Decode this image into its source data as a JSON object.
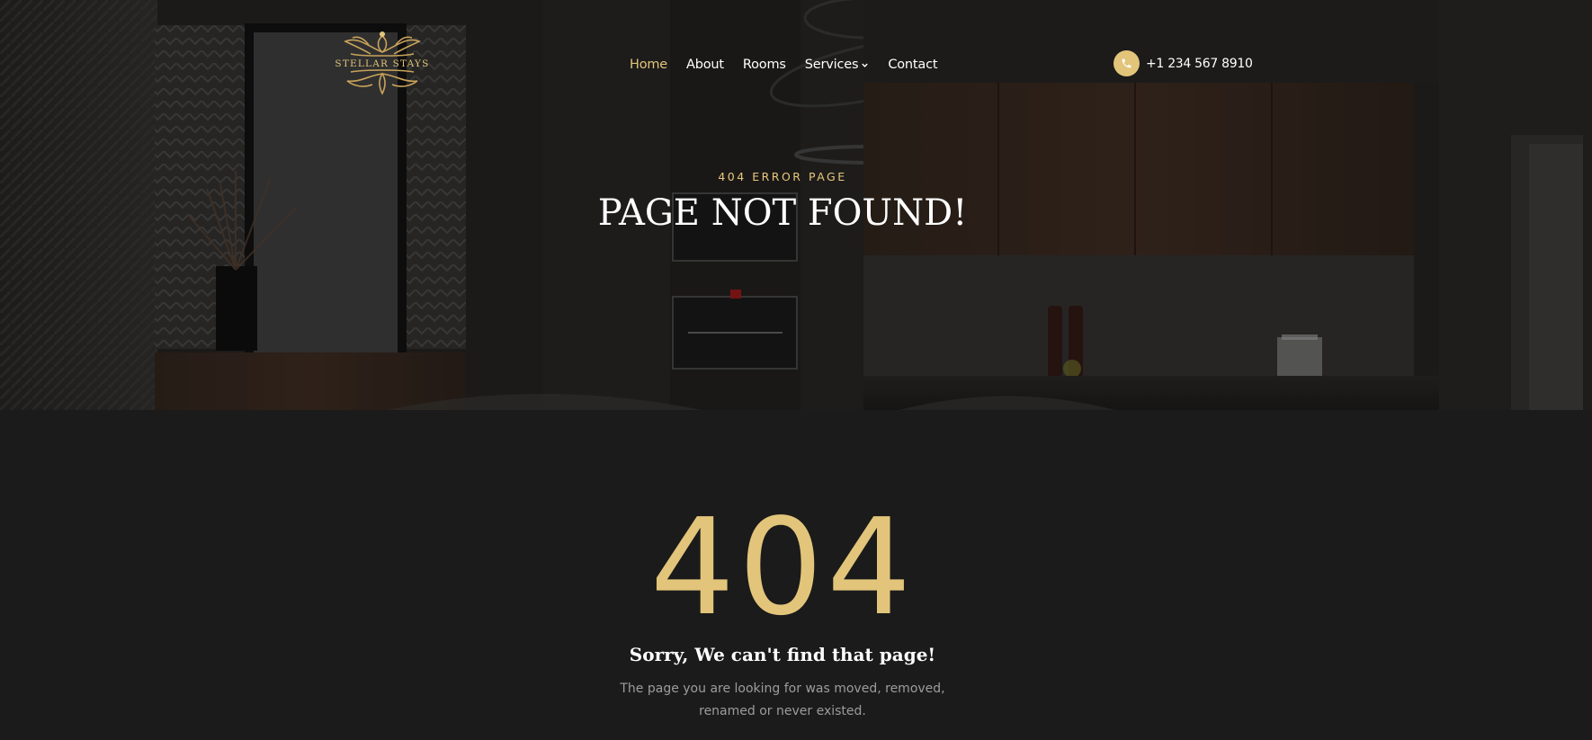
{
  "brand": {
    "name": "STELLAR STAYS",
    "accent": "#e2c57a",
    "background": "#1b1b1b"
  },
  "nav": {
    "items": [
      {
        "label": "Home",
        "active": true
      },
      {
        "label": "About",
        "active": false
      },
      {
        "label": "Rooms",
        "active": false
      },
      {
        "label": "Services",
        "active": false,
        "has_dropdown": true
      },
      {
        "label": "Contact",
        "active": false
      }
    ]
  },
  "contact": {
    "phone": "+1 234 567 8910",
    "icon": "phone-icon"
  },
  "hero": {
    "eyebrow": "404 ERROR PAGE",
    "title": "PAGE NOT FOUND!"
  },
  "error": {
    "code": "404",
    "heading": "Sorry, We can't find that page!",
    "message": "The page you are looking for was moved, removed, renamed or never existed."
  }
}
